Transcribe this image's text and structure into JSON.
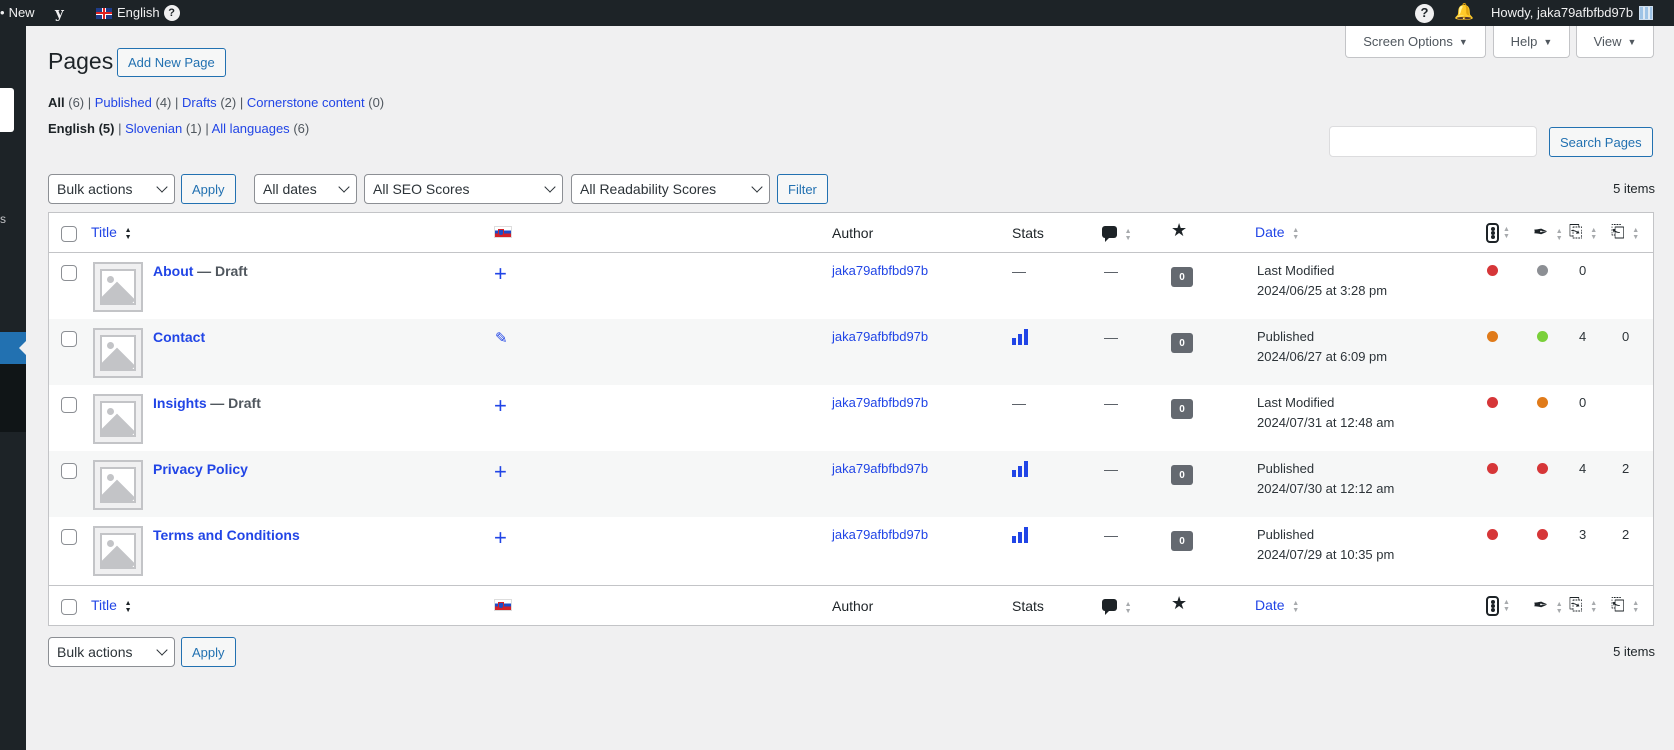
{
  "adminbar": {
    "new_label": "New",
    "yoast_label": "y",
    "language_label": "English",
    "help_icon": "question-icon",
    "bell_icon": "bell-icon",
    "howdy": "Howdy, jaka79afbfbd97b"
  },
  "tabs": {
    "screen_options": "Screen Options",
    "help": "Help",
    "view": "View"
  },
  "page": {
    "title": "Pages",
    "add_new": "Add New Page"
  },
  "status_filters": [
    {
      "label": "All",
      "count": "(6)"
    },
    {
      "label": "Published",
      "count": "(4)"
    },
    {
      "label": "Drafts",
      "count": "(2)"
    },
    {
      "label": "Cornerstone content",
      "count": "(0)"
    }
  ],
  "language_filters": [
    {
      "label": "English",
      "count": "(5)"
    },
    {
      "label": "Slovenian",
      "count": "(1)"
    },
    {
      "label": "All languages",
      "count": "(6)"
    }
  ],
  "search": {
    "button": "Search Pages",
    "value": ""
  },
  "toolbar": {
    "bulk_actions": "Bulk actions",
    "apply": "Apply",
    "all_dates": "All dates",
    "all_seo": "All SEO Scores",
    "all_readability": "All Readability Scores",
    "filter": "Filter",
    "items": "5 items"
  },
  "columns": {
    "title": "Title",
    "author": "Author",
    "stats": "Stats",
    "date": "Date"
  },
  "rows": [
    {
      "title": "About",
      "state": "— Draft",
      "lang_action": "add",
      "author": "jaka79afbfbd97b",
      "stats": "—",
      "comments": "—",
      "cornerstone": "0",
      "date_status": "Last Modified",
      "date": "2024/06/25 at 3:28 pm",
      "seo_color": "#d63638",
      "read_color": "#8c8f94",
      "links_out": "0",
      "links_in": ""
    },
    {
      "title": "Contact",
      "state": "",
      "lang_action": "edit",
      "author": "jaka79afbfbd97b",
      "stats": "bars",
      "comments": "—",
      "cornerstone": "0",
      "date_status": "Published",
      "date": "2024/06/27 at 6:09 pm",
      "seo_color": "#e07b1a",
      "read_color": "#7ad03a",
      "links_out": "4",
      "links_in": "0"
    },
    {
      "title": "Insights",
      "state": "— Draft",
      "lang_action": "add",
      "author": "jaka79afbfbd97b",
      "stats": "—",
      "comments": "—",
      "cornerstone": "0",
      "date_status": "Last Modified",
      "date": "2024/07/31 at 12:48 am",
      "seo_color": "#d63638",
      "read_color": "#e07b1a",
      "links_out": "0",
      "links_in": ""
    },
    {
      "title": "Privacy Policy",
      "state": "",
      "lang_action": "add",
      "author": "jaka79afbfbd97b",
      "stats": "bars",
      "comments": "—",
      "cornerstone": "0",
      "date_status": "Published",
      "date": "2024/07/30 at 12:12 am",
      "seo_color": "#d63638",
      "read_color": "#d63638",
      "links_out": "4",
      "links_in": "2"
    },
    {
      "title": "Terms and Conditions",
      "state": "",
      "lang_action": "add",
      "author": "jaka79afbfbd97b",
      "stats": "bars",
      "comments": "—",
      "cornerstone": "0",
      "date_status": "Published",
      "date": "2024/07/29 at 10:35 pm",
      "seo_color": "#d63638",
      "read_color": "#d63638",
      "links_out": "3",
      "links_in": "2"
    }
  ]
}
